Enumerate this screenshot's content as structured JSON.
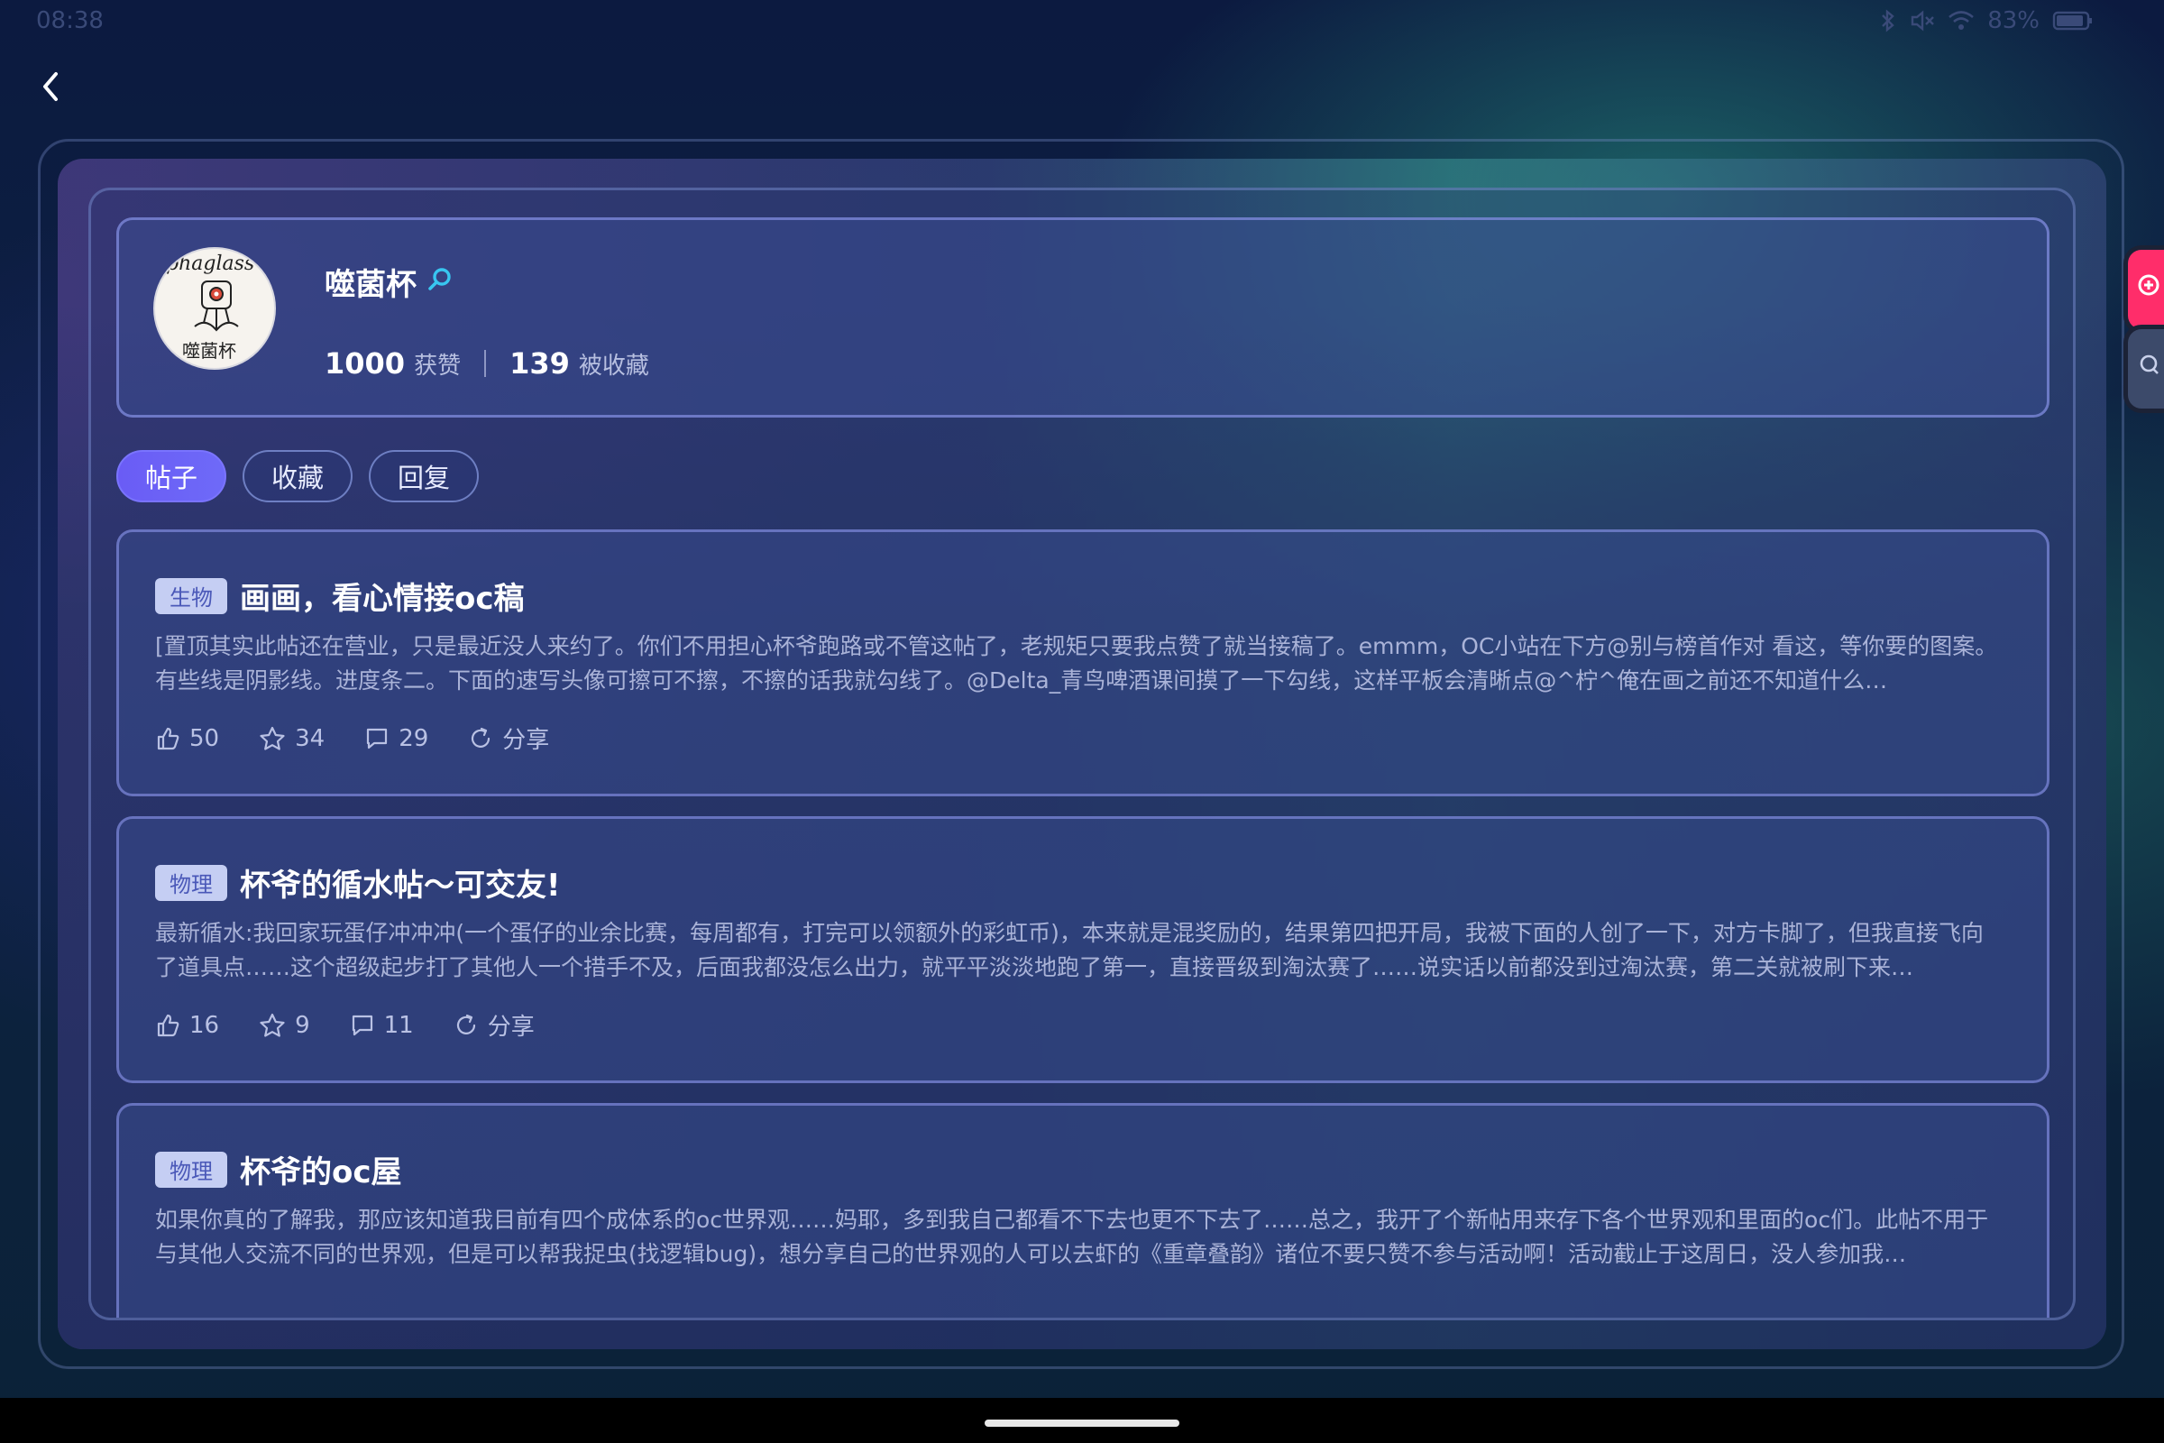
{
  "status_bar": {
    "time": "08:38",
    "battery": "83%"
  },
  "profile": {
    "username": "噬菌杯",
    "avatar_text_top": "phaglass",
    "avatar_text_bottom": "噬菌杯",
    "likes_count": "1000",
    "likes_label": "获赞",
    "favorites_count": "139",
    "favorites_label": "被收藏"
  },
  "tabs": [
    {
      "label": "帖子",
      "active": true
    },
    {
      "label": "收藏",
      "active": false
    },
    {
      "label": "回复",
      "active": false
    }
  ],
  "posts": [
    {
      "tag": "生物",
      "title": "画画，看心情接oc稿",
      "body": "[置顶其实此帖还在营业，只是最近没人来约了。你们不用担心杯爷跑路或不管这帖了，老规矩只要我点赞了就当接稿了。emmm，OC小站在下方@别与榜首作对 看这，等你要的图案。有些线是阴影线。进度条二。下面的速写头像可擦可不擦，不擦的话我就勾线了。@Delta_青鸟啤酒课间摸了一下勾线，这样平板会清晰点@^柠^俺在画之前还不知道什么…",
      "likes": "50",
      "stars": "34",
      "comments": "29",
      "share": "分享"
    },
    {
      "tag": "物理",
      "title": "杯爷的循水帖～可交友!",
      "body": "最新循水:我回家玩蛋仔冲冲冲(一个蛋仔的业余比赛，每周都有，打完可以领额外的彩虹币)，本来就是混奖励的，结果第四把开局，我被下面的人创了一下，对方卡脚了，但我直接飞向了道具点……这个超级起步打了其他人一个措手不及，后面我都没怎么出力，就平平淡淡地跑了第一，直接晋级到淘汰赛了……说实话以前都没到过淘汰赛，第二关就被刷下来…",
      "likes": "16",
      "stars": "9",
      "comments": "11",
      "share": "分享"
    },
    {
      "tag": "物理",
      "title": "杯爷的oc屋",
      "body": "如果你真的了解我，那应该知道我目前有四个成体系的oc世界观……妈耶，多到我自己都看不下去也更不下去了……总之，我开了个新帖用来存下各个世界观和里面的oc们。此帖不用于与其他人交流不同的世界观，但是可以帮我捉虫(找逻辑bug)，想分享自己的世界观的人可以去虾的《重章叠韵》诸位不要只赞不参与活动啊！活动截止于这周日，没人参加我…",
      "likes": "",
      "stars": "",
      "comments": "",
      "share": ""
    }
  ],
  "colors": {
    "accent": "#6a5cf5",
    "tag_bg": "#c5cef3",
    "tag_text": "#4a58b8",
    "float_red": "#ff2d6a"
  }
}
